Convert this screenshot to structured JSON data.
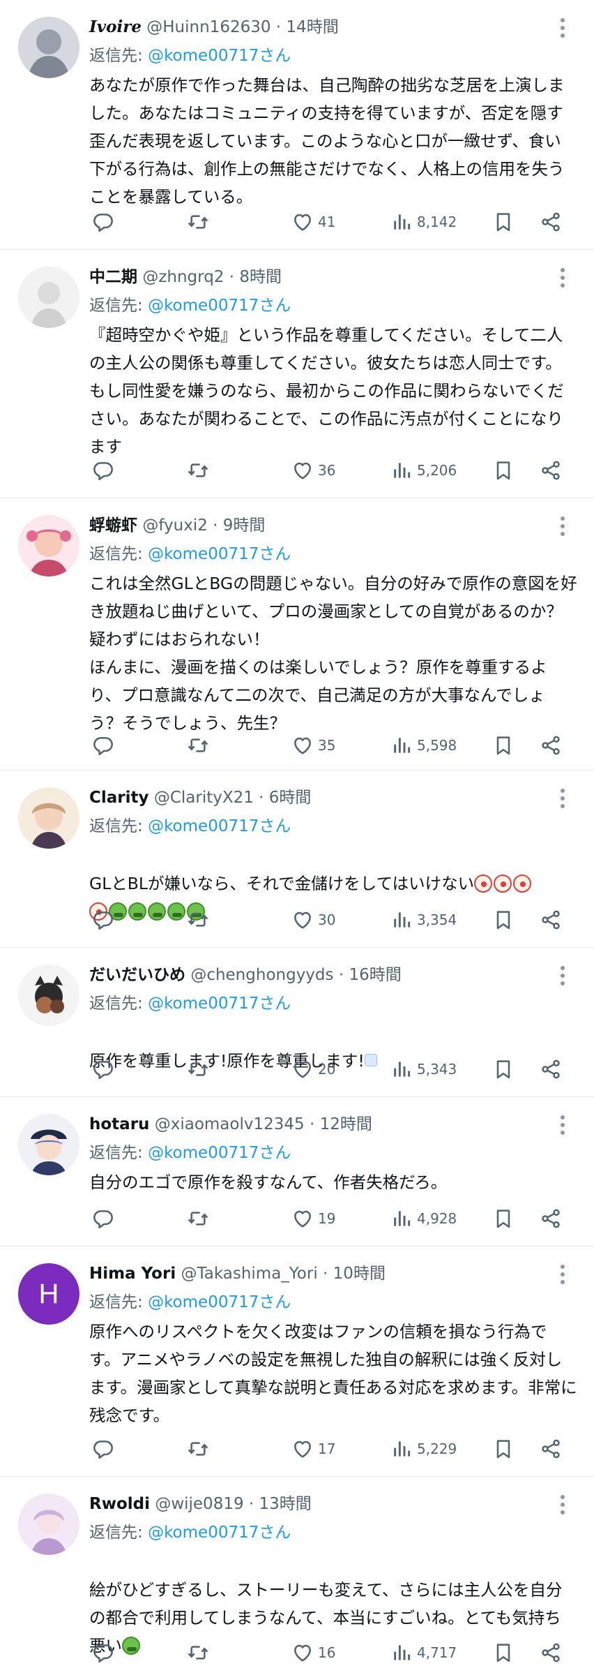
{
  "posts": [
    {
      "name": "Ivoire",
      "handle": "@Huinn162630",
      "time": "14時間",
      "reply_prefix": "返信先:",
      "reply_mention": "@kome00717さん",
      "text": "あなたが原作で作った舞台は、自己陶酔の拙劣な芝居を上演しました。あなたはコミュニティの支持を得ていますが、否定を隠す歪んだ表現を返しています。このような心と口が一緻せず、食い下がる行為は、創作上の無能さだけでなく、人格上の信用を失うことを暴露している。",
      "likes": "41",
      "views": "8,142"
    },
    {
      "name": "中二期",
      "handle": "@zhngrq2",
      "time": "8時間",
      "reply_prefix": "返信先:",
      "reply_mention": "@kome00717さん",
      "text": "『超時空かぐや姫』という作品を尊重してください。そして二人の主人公の関係も尊重してください。彼女たちは恋人同士です。もし同性愛を嫌うのなら、最初からこの作品に関わらないでください。あなたが関わることで、この作品に汚点が付くことになります",
      "likes": "36",
      "views": "5,206"
    },
    {
      "name": "蜉蝣虾",
      "handle": "@fyuxi2",
      "time": "9時間",
      "reply_prefix": "返信先:",
      "reply_mention": "@kome00717さん",
      "text": "これは全然GLとBGの問題じゃない。自分の好みで原作の意図を好き放題ねじ曲げといて、プロの漫画家としての自覚があるのか？疑わずにはおられない！\nほんまに、漫画を描くのは楽しいでしょう？原作を尊重するより、プロ意識なんて二の次で、自己満足の方が大事なんでしょう？そうでしょう、先生？",
      "likes": "35",
      "views": "5,598"
    },
    {
      "name": "Clarity",
      "handle": "@ClarityX21",
      "time": "6時間",
      "reply_prefix": "返信先:",
      "reply_mention": "@kome00717さん",
      "text": "GLとBLが嫌いなら、それで金儲けをしてはいけない",
      "likes": "30",
      "views": "3,354"
    },
    {
      "name": "だいだいひめ",
      "handle": "@chenghongyyds",
      "time": "16時間",
      "reply_prefix": "返信先:",
      "reply_mention": "@kome00717さん",
      "text": "原作を尊重します!原作を尊重します!",
      "likes": "20",
      "views": "5,343"
    },
    {
      "name": "hotaru",
      "handle": "@xiaomaolv12345",
      "time": "12時間",
      "reply_prefix": "返信先:",
      "reply_mention": "@kome00717さん",
      "text": "自分のエゴで原作を殺すなんて、作者失格だろ。",
      "likes": "19",
      "views": "4,928"
    },
    {
      "name": "Hima Yori",
      "handle": "@Takashima_Yori",
      "time": "10時間",
      "avatar_letter": "H",
      "reply_prefix": "返信先:",
      "reply_mention": "@kome00717さん",
      "text": "原作へのリスペクトを欠く改変はファンの信頼を損なう行為です。アニメやラノベの設定を無視した独自の解釈には強く反対します。漫画家として真摯な説明と責任ある対応を求めます。非常に残念です。",
      "likes": "17",
      "views": "5,229"
    },
    {
      "name": "Rwoldi",
      "handle": "@wije0819",
      "time": "13時間",
      "reply_prefix": "返信先:",
      "reply_mention": "@kome00717さん",
      "text": "絵がひどすぎるし、ストーリーも変えて、さらには主人公を自分の都合で利用してしまうなんて、本当にすごいね。とても気持ち悪い",
      "likes": "16",
      "views": "4,717"
    }
  ],
  "colors": {
    "text": "#0f1419",
    "secondary": "#536471",
    "link": "#1d9bf0",
    "divider": "#e4e9ec",
    "avatar_h": "#7b2cbf"
  },
  "icons": {
    "reply": "reply-icon",
    "retweet": "retweet-icon",
    "like": "heart-icon",
    "views": "views-chart-icon",
    "bookmark": "bookmark-icon",
    "share": "share-icon",
    "more": "more-dots-icon"
  }
}
